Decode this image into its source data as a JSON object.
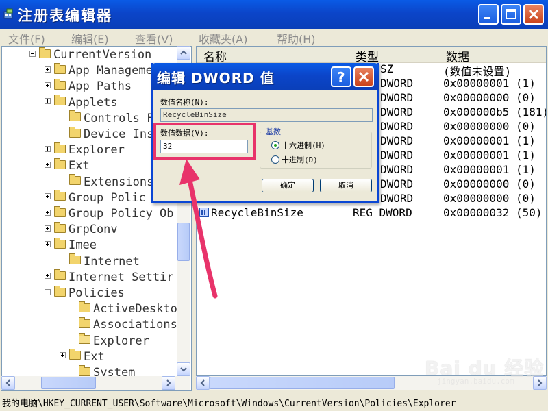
{
  "window": {
    "title": "注册表编辑器"
  },
  "menu": [
    {
      "label": "文件(F)"
    },
    {
      "label": "编辑(E)"
    },
    {
      "label": "查看(V)"
    },
    {
      "label": "收藏夹(A)"
    },
    {
      "label": "帮助(H)"
    }
  ],
  "tree": {
    "items": [
      {
        "label": "CurrentVersion",
        "expander": "minus",
        "open": false
      },
      {
        "label": "App Manageme",
        "expander": "plus",
        "open": false
      },
      {
        "label": "App Paths",
        "expander": "plus",
        "open": false
      },
      {
        "label": "Applets",
        "expander": "plus",
        "open": false
      },
      {
        "label": "Controls Fo",
        "expander": "none",
        "open": false
      },
      {
        "label": "Device Insta",
        "expander": "none",
        "open": false
      },
      {
        "label": "Explorer",
        "expander": "plus",
        "open": false
      },
      {
        "label": "Ext",
        "expander": "plus",
        "open": false
      },
      {
        "label": "Extensions",
        "expander": "none",
        "open": false
      },
      {
        "label": "Group Polic",
        "expander": "plus",
        "open": false
      },
      {
        "label": "Group Policy Ob",
        "expander": "plus",
        "open": false
      },
      {
        "label": "GrpConv",
        "expander": "plus",
        "open": false
      },
      {
        "label": "Imee",
        "expander": "plus",
        "open": false
      },
      {
        "label": "Internet",
        "expander": "none",
        "open": false
      },
      {
        "label": "Internet Settir",
        "expander": "plus",
        "open": false
      },
      {
        "label": "Policies",
        "expander": "minus",
        "open": false
      },
      {
        "label": "ActiveDesktop",
        "expander": "none",
        "open": false
      },
      {
        "label": "Associations",
        "expander": "none",
        "open": false
      },
      {
        "label": "Explorer",
        "expander": "none",
        "open": true
      },
      {
        "label": "Ext",
        "expander": "plus",
        "open": false
      },
      {
        "label": "System",
        "expander": "none",
        "open": false
      }
    ]
  },
  "list": {
    "headers": {
      "name": "名称",
      "type": "类型",
      "data": "数据"
    },
    "rows": [
      {
        "name": "",
        "type": "SZ",
        "data": "(数值未设置)"
      },
      {
        "name": "",
        "type": "DWORD",
        "data": "0x00000001 (1)"
      },
      {
        "name": "",
        "type": "DWORD",
        "data": "0x00000000 (0)"
      },
      {
        "name": "",
        "type": "DWORD",
        "data": "0x000000b5 (181)"
      },
      {
        "name": "",
        "type": "DWORD",
        "data": "0x00000000 (0)"
      },
      {
        "name": "",
        "type": "DWORD",
        "data": "0x00000001 (1)"
      },
      {
        "name": "",
        "type": "DWORD",
        "data": "0x00000001 (1)"
      },
      {
        "name": "",
        "type": "DWORD",
        "data": "0x00000001 (1)"
      },
      {
        "name": "",
        "type": "DWORD",
        "data": "0x00000000 (0)"
      },
      {
        "name": "",
        "type": "DWORD",
        "data": "0x00000000 (0)"
      },
      {
        "name": "RecycleBinSize",
        "type": "REG_DWORD",
        "data": "0x00000032 (50)"
      }
    ]
  },
  "statusbar": {
    "path": "我的电脑\\HKEY_CURRENT_USER\\Software\\Microsoft\\Windows\\CurrentVersion\\Policies\\Explorer"
  },
  "dialog": {
    "title": "编辑 DWORD 值",
    "value_name_label": "数值名称(N):",
    "value_name": "RecycleBinSize",
    "value_data_label": "数值数据(V):",
    "value_data": "32",
    "base_label": "基数",
    "hex_label": "十六进制(H)",
    "dec_label": "十进制(D)",
    "base_selected": "hex",
    "ok_label": "确定",
    "cancel_label": "取消"
  },
  "colors": {
    "titlebar": "#0b45c9",
    "highlight": "#e8336a"
  },
  "watermark": {
    "text": "Bai du 经验",
    "sub": "jingyan.baidu.com"
  }
}
